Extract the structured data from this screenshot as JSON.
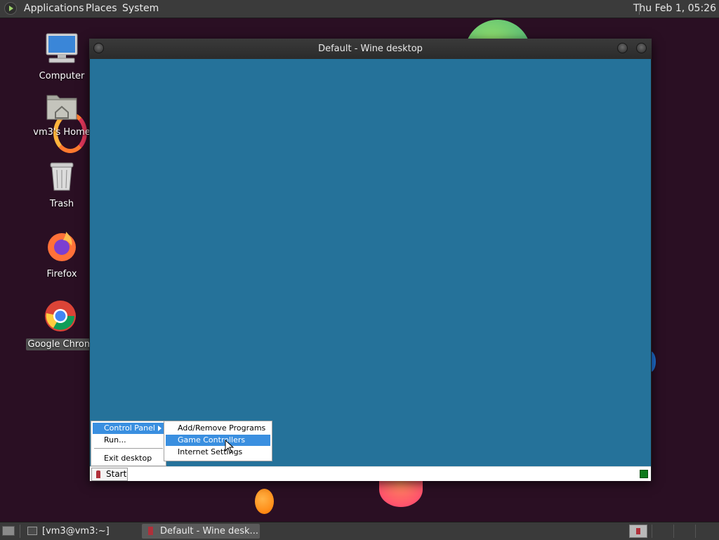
{
  "top_panel": {
    "applications": "Applications",
    "places": "Places",
    "system": "System",
    "clock": "Thu Feb  1, 05:26"
  },
  "desktop_icons": [
    {
      "label": "Computer",
      "icon": "computer-icon"
    },
    {
      "label": "vm3's Home",
      "icon": "home-folder-icon"
    },
    {
      "label": "Trash",
      "icon": "trash-icon"
    },
    {
      "label": "Firefox",
      "icon": "firefox-icon"
    },
    {
      "label": "Google Chrom",
      "icon": "chrome-icon"
    }
  ],
  "wine_window": {
    "title": "Default - Wine desktop",
    "desktop_color": "#25729a"
  },
  "wine_taskbar": {
    "start_label": "Start"
  },
  "start_menu": {
    "items": [
      {
        "label": "Control Panel",
        "has_submenu": true,
        "highlighted": true
      },
      {
        "label": "Run..."
      },
      {
        "label": "Exit desktop"
      }
    ]
  },
  "control_panel_submenu": {
    "items": [
      {
        "label": "Add/Remove Programs"
      },
      {
        "label": "Game Controllers",
        "highlighted": true
      },
      {
        "label": "Internet Settings"
      }
    ]
  },
  "bottom_panel": {
    "tasks": [
      {
        "label": "[vm3@vm3:~]",
        "icon": "terminal-icon"
      },
      {
        "label": "Default - Wine desk...",
        "icon": "wine-icon",
        "active": true
      }
    ]
  },
  "colors": {
    "highlight": "#3a8fe0",
    "panel": "#3b3b3b",
    "wallpaper": "#2a0f23"
  }
}
